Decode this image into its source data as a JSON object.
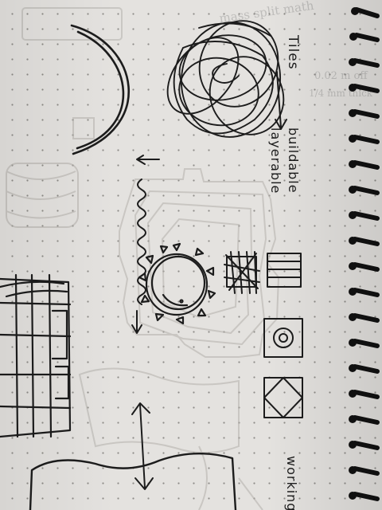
{
  "notes": {
    "tiles": "Tiles",
    "buildable": "buildable",
    "layerable": "layerable",
    "working": "working"
  },
  "ghost_notes": {
    "line1": "mass  split  math",
    "line2": "0.02 m  off",
    "line3": "1/4 mm  thick"
  },
  "colors": {
    "paper": "#e4e2df",
    "ink": "#1c1c1c",
    "binding": "#111111",
    "dots": "#8e8c88"
  }
}
